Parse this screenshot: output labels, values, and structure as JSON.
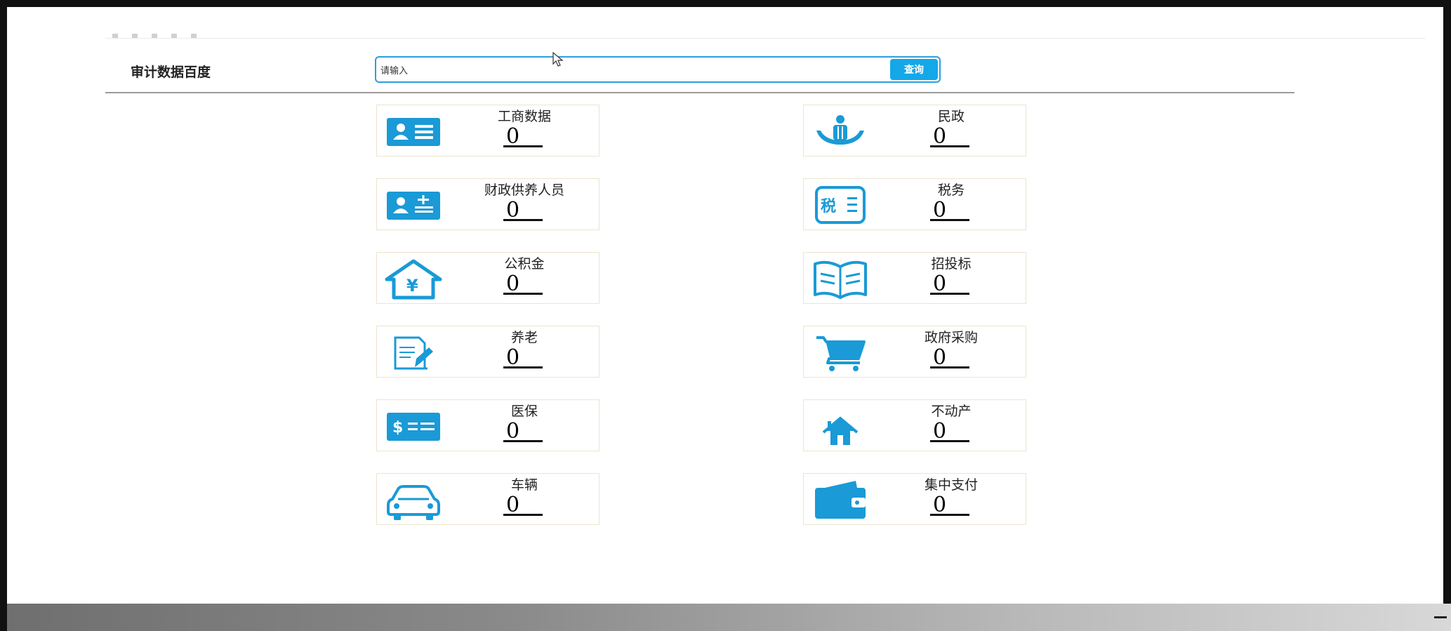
{
  "header": {
    "title": "审计数据百度"
  },
  "search": {
    "placeholder": "请输入",
    "value": "",
    "button_label": "查询"
  },
  "colors": {
    "accent": "#14a8e8",
    "icon": "#1a9ad6",
    "card_border": "#ece4cf"
  },
  "cards": [
    {
      "label": "工商数据",
      "count": "0",
      "icon": "id-card-icon"
    },
    {
      "label": "民政",
      "count": "0",
      "icon": "hands-people-icon"
    },
    {
      "label": "财政供养人员",
      "count": "0",
      "icon": "user-card-plus-icon"
    },
    {
      "label": "税务",
      "count": "0",
      "icon": "tax-icon"
    },
    {
      "label": "公积金",
      "count": "0",
      "icon": "house-yen-icon"
    },
    {
      "label": "招投标",
      "count": "0",
      "icon": "open-book-icon"
    },
    {
      "label": "养老",
      "count": "0",
      "icon": "document-edit-icon"
    },
    {
      "label": "政府采购",
      "count": "0",
      "icon": "shopping-cart-icon"
    },
    {
      "label": "医保",
      "count": "0",
      "icon": "dollar-card-icon"
    },
    {
      "label": "不动产",
      "count": "0",
      "icon": "home-icon"
    },
    {
      "label": "车辆",
      "count": "0",
      "icon": "car-icon"
    },
    {
      "label": "集中支付",
      "count": "0",
      "icon": "wallet-icon"
    }
  ]
}
